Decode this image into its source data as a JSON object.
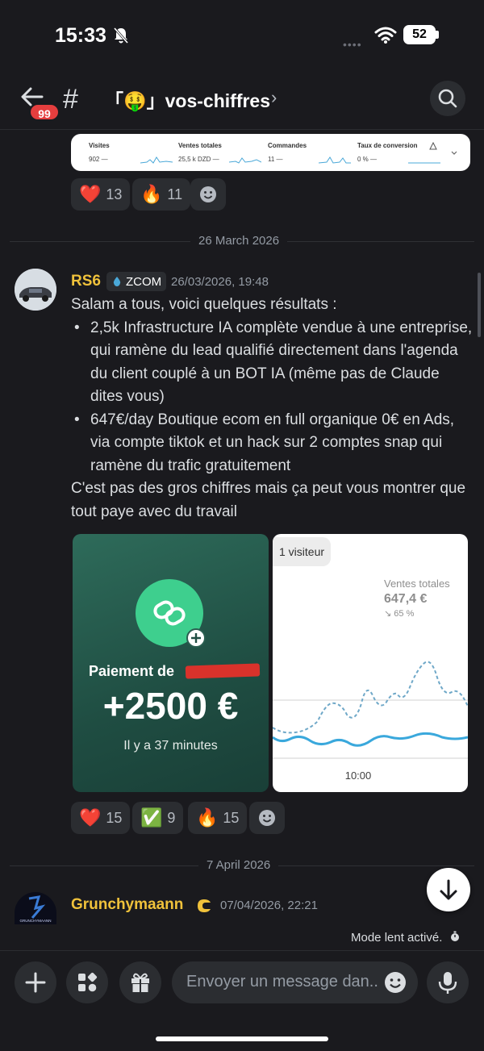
{
  "status_bar": {
    "time": "15:33",
    "battery": "52"
  },
  "header": {
    "unread_badge": "99",
    "hash": "#",
    "channel_name": "「🤑」vos-chiffres",
    "chevron": "›"
  },
  "stats_card": {
    "items": [
      {
        "label": "Visites",
        "value": "902 —"
      },
      {
        "label": "Ventes totales",
        "value": "25,5 k DZD —"
      },
      {
        "label": "Commandes",
        "value": "11 —"
      },
      {
        "label": "Taux de conversion",
        "value": "0 % —"
      }
    ]
  },
  "reactions_1": [
    {
      "emoji": "❤️",
      "count": "13"
    },
    {
      "emoji": "🔥",
      "count": "11"
    }
  ],
  "date_sep_1": "26 March 2026",
  "message_1": {
    "username": "RS6",
    "username_color": "#f0c23b",
    "tag": "ZCOM",
    "timestamp": "26/03/2026, 19:48",
    "intro": "Salam a tous, voici quelques résultats :",
    "bullets": [
      "2,5k Infrastructure IA complète vendue à une entreprise, qui ramène du lead qualifié directement dans l'agenda du client couplé à un BOT IA (même pas de Claude dites vous)",
      "647€/day Boutique ecom en full organique 0€ en Ads, via compte tiktok et un hack sur 2 comptes snap qui ramène du trafic gratuitement"
    ],
    "outro": "C'est pas des gros chiffres mais ça peut vous montrer que tout paye avec du travail"
  },
  "attachment_left": {
    "payment_label": "Paiement de",
    "amount": "+2500 €",
    "time_ago": "Il y a 37 minutes"
  },
  "attachment_right": {
    "visitors_chip": "1 visiteur",
    "metric_label": "Ventes totales",
    "metric_value": "647,4 €",
    "metric_change": "↘ 65 %",
    "time_label": "10:00"
  },
  "reactions_2": [
    {
      "emoji": "❤️",
      "count": "15"
    },
    {
      "emoji": "✅",
      "count": "9"
    },
    {
      "emoji": "🔥",
      "count": "15"
    }
  ],
  "date_sep_2": "7 April 2026",
  "message_2": {
    "username": "Grunchymaann",
    "username_color": "#f0c23b",
    "timestamp": "07/04/2026, 22:21",
    "avatar_text": "GRUNCHYMAANN"
  },
  "slow_mode": "Mode lent activé.",
  "composer": {
    "placeholder": "Envoyer un message dan.."
  },
  "colors": {
    "background": "#1a1a1e",
    "surface": "#2b2d31",
    "accent_green": "#3ecf8e",
    "badge_red": "#e53e3e"
  }
}
